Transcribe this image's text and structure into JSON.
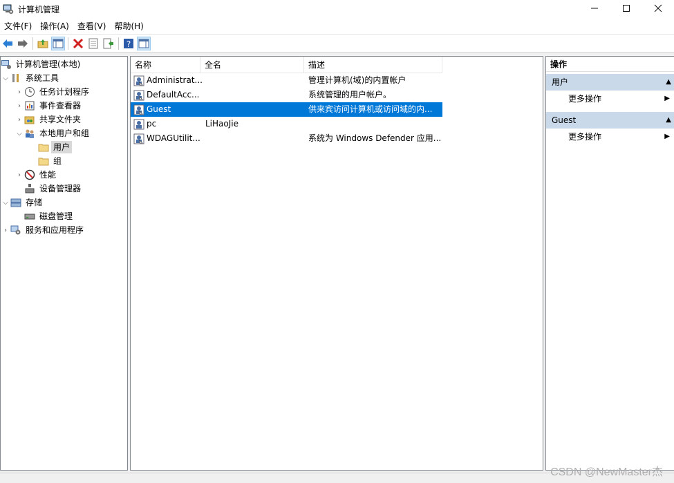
{
  "window": {
    "title": "计算机管理"
  },
  "menu": [
    "文件(F)",
    "操作(A)",
    "查看(V)",
    "帮助(H)"
  ],
  "tree": {
    "root": "计算机管理(本地)",
    "system_tools": "系统工具",
    "task_scheduler": "任务计划程序",
    "event_viewer": "事件查看器",
    "shared_folders": "共享文件夹",
    "local_users_groups": "本地用户和组",
    "users": "用户",
    "groups": "组",
    "performance": "性能",
    "device_manager": "设备管理器",
    "storage": "存储",
    "disk_management": "磁盘管理",
    "services_apps": "服务和应用程序"
  },
  "list": {
    "headers": [
      "名称",
      "全名",
      "描述"
    ],
    "rows": [
      {
        "name": "Administrat...",
        "fullname": "",
        "desc": "管理计算机(域)的内置帐户",
        "selected": false
      },
      {
        "name": "DefaultAcc...",
        "fullname": "",
        "desc": "系统管理的用户帐户。",
        "selected": false
      },
      {
        "name": "Guest",
        "fullname": "",
        "desc": "供来宾访问计算机或访问域的内...",
        "selected": true
      },
      {
        "name": "pc",
        "fullname": "LiHaoJie",
        "desc": "",
        "selected": false
      },
      {
        "name": "WDAGUtilit...",
        "fullname": "",
        "desc": "系统为 Windows Defender 应用...",
        "selected": false
      }
    ]
  },
  "actions": {
    "title": "操作",
    "sections": [
      {
        "label": "用户",
        "item": "更多操作"
      },
      {
        "label": "Guest",
        "item": "更多操作"
      }
    ]
  },
  "watermark": "CSDN @NewMaster杰",
  "colors": {
    "selection": "#0078d7",
    "section_header": "#c9d9ea"
  }
}
